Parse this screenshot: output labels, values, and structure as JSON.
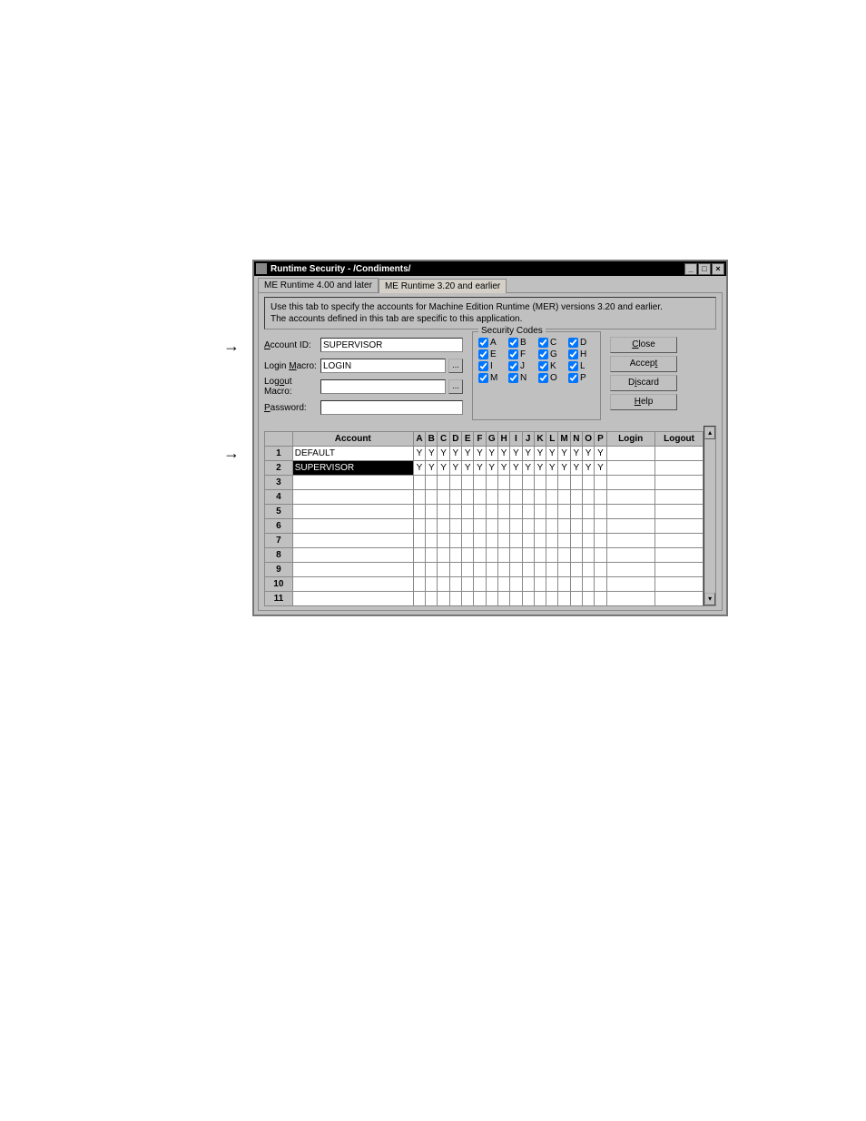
{
  "window": {
    "title": "Runtime Security - /Condiments/"
  },
  "tabs": {
    "tab1": "ME Runtime 4.00 and later",
    "tab2": "ME Runtime 3.20 and earlier"
  },
  "description": {
    "line1": "Use this tab to specify the accounts for Machine Edition Runtime (MER) versions 3.20 and earlier.",
    "line2": "The accounts defined in this tab are specific to this application."
  },
  "form": {
    "account_id_label": "Account ID:",
    "account_id_value": "SUPERVISOR",
    "login_macro_label": "Login Macro:",
    "login_macro_value": "LOGIN",
    "logout_macro_label": "Logout Macro:",
    "logout_macro_value": "",
    "password_label": "Password:",
    "password_value": ""
  },
  "security_codes": {
    "legend": "Security Codes",
    "A": "A",
    "B": "B",
    "C": "C",
    "D": "D",
    "E": "E",
    "F": "F",
    "G": "G",
    "H": "H",
    "I": "I",
    "J": "J",
    "K": "K",
    "L": "L",
    "M": "M",
    "N": "N",
    "O": "O",
    "P": "P"
  },
  "buttons": {
    "close": "Close",
    "accept": "Accept",
    "discard": "Discard",
    "help": "Help"
  },
  "grid": {
    "headers": {
      "account": "Account",
      "login": "Login",
      "logout": "Logout",
      "A": "A",
      "B": "B",
      "C": "C",
      "D": "D",
      "E": "E",
      "F": "F",
      "G": "G",
      "H": "H",
      "I": "I",
      "J": "J",
      "K": "K",
      "L": "L",
      "M": "M",
      "N": "N",
      "O": "O",
      "P": "P"
    },
    "rows": [
      {
        "num": "1",
        "account": "DEFAULT",
        "y": [
          "Y",
          "Y",
          "Y",
          "Y",
          "Y",
          "Y",
          "Y",
          "Y",
          "Y",
          "Y",
          "Y",
          "Y",
          "Y",
          "Y",
          "Y",
          "Y"
        ],
        "login": "",
        "logout": "",
        "sel": false
      },
      {
        "num": "2",
        "account": "SUPERVISOR",
        "y": [
          "Y",
          "Y",
          "Y",
          "Y",
          "Y",
          "Y",
          "Y",
          "Y",
          "Y",
          "Y",
          "Y",
          "Y",
          "Y",
          "Y",
          "Y",
          "Y"
        ],
        "login": "",
        "logout": "",
        "sel": true
      },
      {
        "num": "3",
        "account": "",
        "y": [
          "",
          "",
          "",
          "",
          "",
          "",
          "",
          "",
          "",
          "",
          "",
          "",
          "",
          "",
          "",
          ""
        ],
        "login": "",
        "logout": "",
        "sel": false
      },
      {
        "num": "4",
        "account": "",
        "y": [
          "",
          "",
          "",
          "",
          "",
          "",
          "",
          "",
          "",
          "",
          "",
          "",
          "",
          "",
          "",
          ""
        ],
        "login": "",
        "logout": "",
        "sel": false
      },
      {
        "num": "5",
        "account": "",
        "y": [
          "",
          "",
          "",
          "",
          "",
          "",
          "",
          "",
          "",
          "",
          "",
          "",
          "",
          "",
          "",
          ""
        ],
        "login": "",
        "logout": "",
        "sel": false
      },
      {
        "num": "6",
        "account": "",
        "y": [
          "",
          "",
          "",
          "",
          "",
          "",
          "",
          "",
          "",
          "",
          "",
          "",
          "",
          "",
          "",
          ""
        ],
        "login": "",
        "logout": "",
        "sel": false
      },
      {
        "num": "7",
        "account": "",
        "y": [
          "",
          "",
          "",
          "",
          "",
          "",
          "",
          "",
          "",
          "",
          "",
          "",
          "",
          "",
          "",
          ""
        ],
        "login": "",
        "logout": "",
        "sel": false
      },
      {
        "num": "8",
        "account": "",
        "y": [
          "",
          "",
          "",
          "",
          "",
          "",
          "",
          "",
          "",
          "",
          "",
          "",
          "",
          "",
          "",
          ""
        ],
        "login": "",
        "logout": "",
        "sel": false
      },
      {
        "num": "9",
        "account": "",
        "y": [
          "",
          "",
          "",
          "",
          "",
          "",
          "",
          "",
          "",
          "",
          "",
          "",
          "",
          "",
          "",
          ""
        ],
        "login": "",
        "logout": "",
        "sel": false
      },
      {
        "num": "10",
        "account": "",
        "y": [
          "",
          "",
          "",
          "",
          "",
          "",
          "",
          "",
          "",
          "",
          "",
          "",
          "",
          "",
          "",
          ""
        ],
        "login": "",
        "logout": "",
        "sel": false
      },
      {
        "num": "11",
        "account": "",
        "y": [
          "",
          "",
          "",
          "",
          "",
          "",
          "",
          "",
          "",
          "",
          "",
          "",
          "",
          "",
          "",
          ""
        ],
        "login": "",
        "logout": "",
        "sel": false
      }
    ]
  }
}
